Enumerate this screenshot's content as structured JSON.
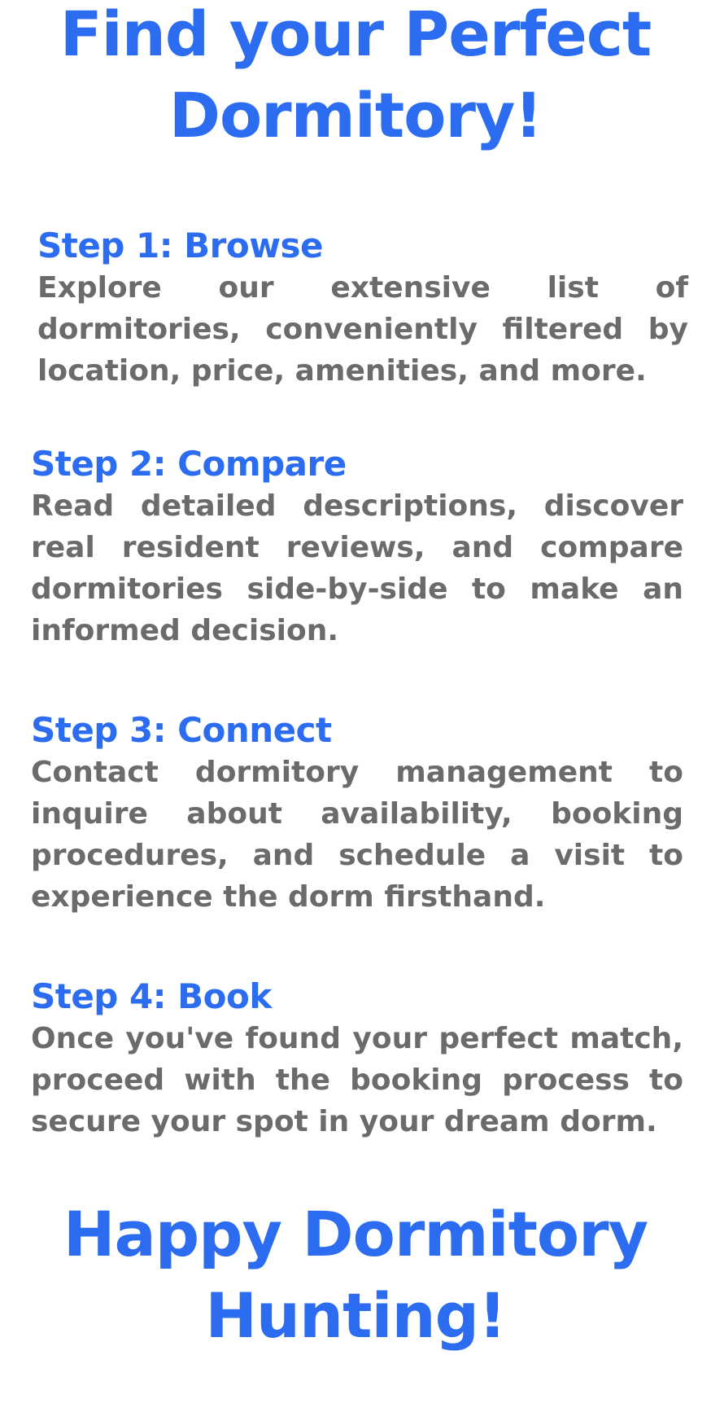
{
  "header": {
    "title_line1": "Find your Perfect",
    "title_line2": "Dormitory!"
  },
  "steps": [
    {
      "title": "Step 1: Browse",
      "body": "Explore our extensive list of dormitories, conveniently filtered by location, price, amenities, and more."
    },
    {
      "title": "Step 2: Compare",
      "body": "Read detailed descriptions, discover real resident reviews, and compare dormitories side-by-side to make an informed decision."
    },
    {
      "title": "Step 3: Connect",
      "body": "Contact dormitory management to inquire about availability, booking procedures, and schedule a visit to experience the dorm firsthand."
    },
    {
      "title": "Step 4: Book",
      "body": "Once you've found your perfect match, proceed with the booking process to secure your spot in your dream dorm."
    }
  ],
  "footer": {
    "title_line1": "Happy Dormitory",
    "title_line2": "Hunting!"
  },
  "colors": {
    "accent": "#2b6cf0",
    "body_text": "#6b6b6b",
    "background": "#ffffff"
  }
}
